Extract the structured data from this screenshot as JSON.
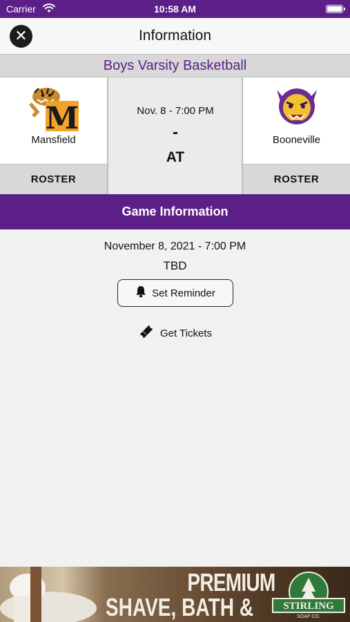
{
  "status_bar": {
    "carrier": "Carrier",
    "time": "10:58 AM"
  },
  "nav": {
    "title": "Information"
  },
  "event": {
    "title": "Boys Varsity Basketball"
  },
  "home_team": {
    "name": "Mansfield",
    "roster_label": "ROSTER",
    "logo_letter": "M"
  },
  "away_team": {
    "name": "Booneville",
    "roster_label": "ROSTER"
  },
  "matchup": {
    "datetime": "Nov. 8 - 7:00 PM",
    "score": "-",
    "separator": "AT"
  },
  "game_info": {
    "header": "Game Information",
    "date": "November 8, 2021 - 7:00 PM",
    "venue": "TBD",
    "reminder_label": "Set Reminder",
    "tickets_label": "Get Tickets"
  },
  "ad": {
    "line1": "PREMIUM",
    "line2": "SHAVE, BATH & BODY",
    "brand": "STIRLING",
    "brand_sub": "SOAP CO."
  },
  "colors": {
    "accent": "#5c1f88",
    "bar_gray": "#d8d8d8",
    "background": "#f1f1f1"
  },
  "icons": [
    "wifi-icon",
    "battery-icon",
    "close-icon",
    "bell-icon",
    "ticket-icon"
  ]
}
